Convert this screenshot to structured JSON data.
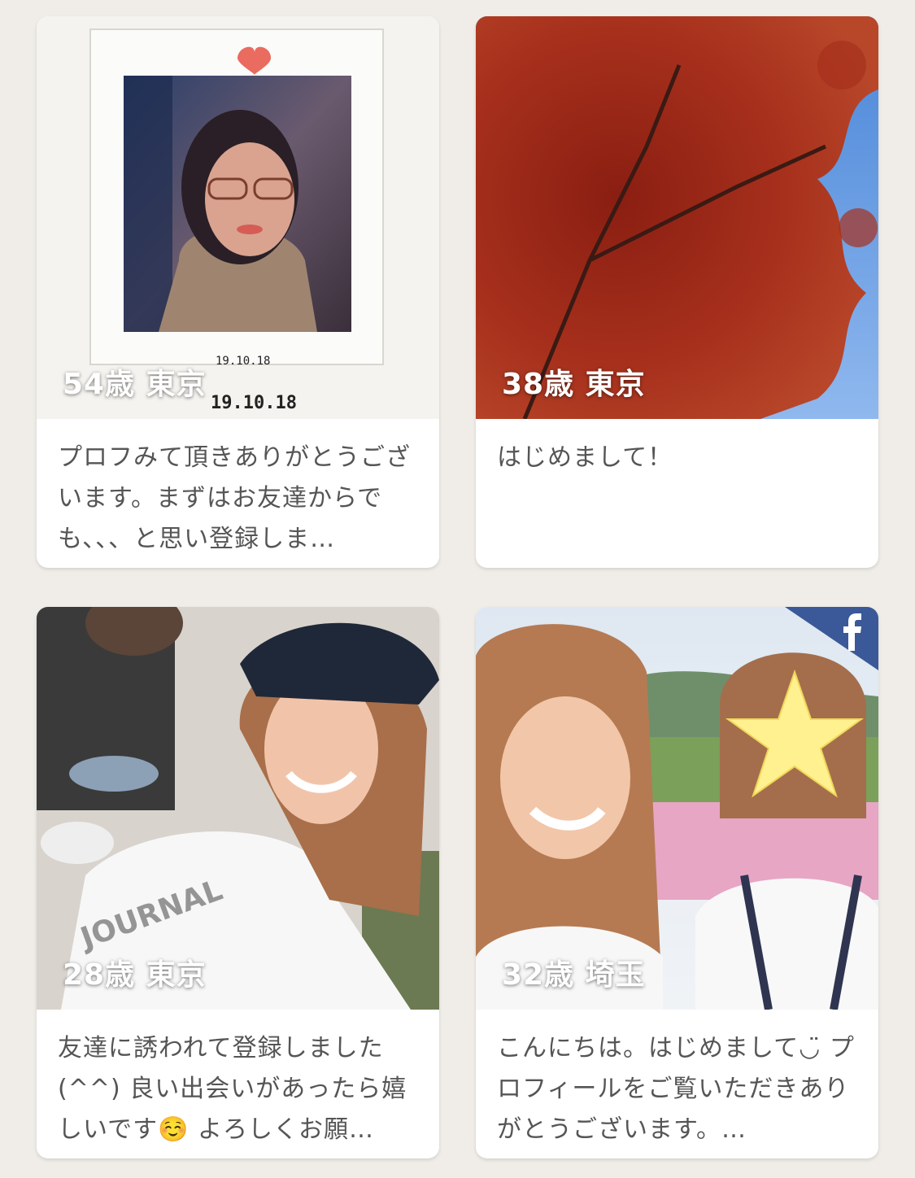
{
  "cards": [
    {
      "age_location": "54歳 東京",
      "message": "プロフみて頂きありがとうございます。まずはお友達からでも、、、と思い登録しま…",
      "photo": "polaroid-portrait",
      "photo_date": "19.10.18"
    },
    {
      "age_location": "38歳 東京",
      "message": "はじめまして！",
      "photo": "autumn-maple-tree"
    },
    {
      "age_location": "28歳 東京",
      "message": "友達に誘われて登録しました(^^) 良い出会いがあったら嬉しいです☺️ よろしくお願…",
      "photo": "selfie-cafe"
    },
    {
      "age_location": "32歳 埼玉",
      "message": "こんにちは。はじめまして◡̈ プロフィールをご覧いただきありがとうございます。…",
      "photo": "two-friends-flower-field",
      "badge_icon": "facebook-icon"
    }
  ],
  "colors": {
    "background": "#f0ede8",
    "card": "#ffffff",
    "text": "#555555",
    "facebook": "#3b5998",
    "heart": "#ea6b5f"
  }
}
